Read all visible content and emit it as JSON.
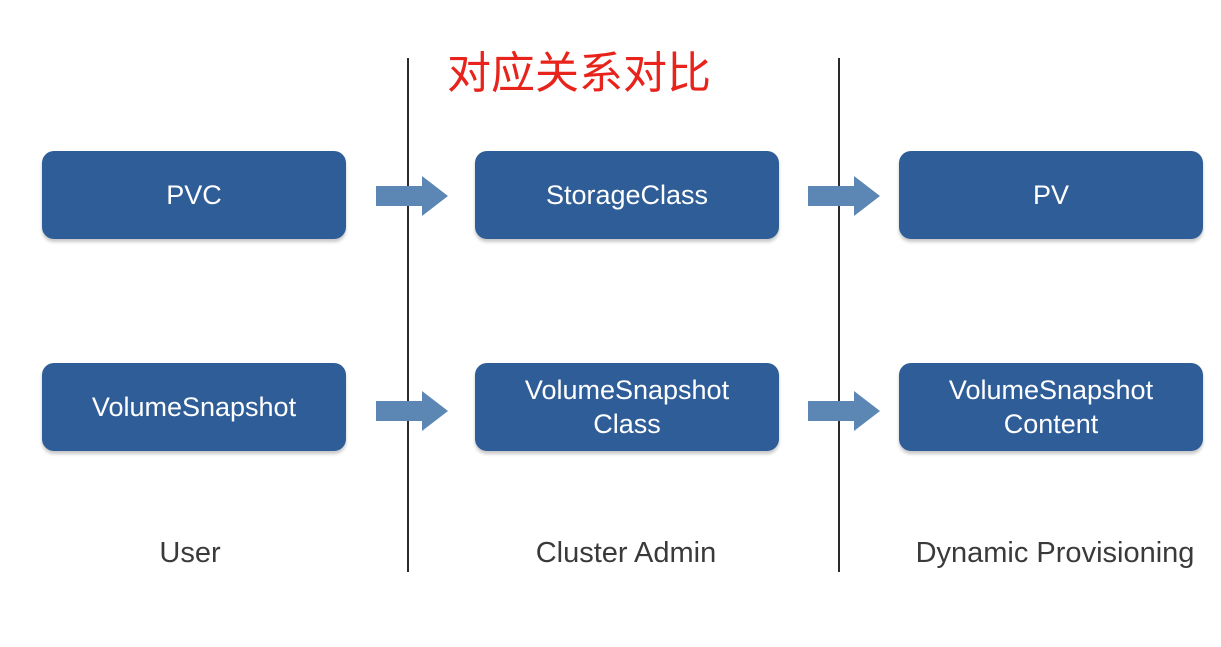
{
  "title": "对应关系对比",
  "rows": [
    {
      "user": [
        "PVC"
      ],
      "cluster_admin": [
        "StorageClass"
      ],
      "dynamic_provisioning": [
        "PV"
      ]
    },
    {
      "user": [
        "VolumeSnapshot"
      ],
      "cluster_admin": [
        "VolumeSnapshot",
        "Class"
      ],
      "dynamic_provisioning": [
        "VolumeSnapshot",
        "Content"
      ]
    }
  ],
  "columns": {
    "user": "User",
    "cluster_admin": "Cluster Admin",
    "dynamic_provisioning": "Dynamic Provisioning"
  },
  "colors": {
    "box": "#2f5d98",
    "arrow": "#5c86b4",
    "title": "#e8231b"
  }
}
